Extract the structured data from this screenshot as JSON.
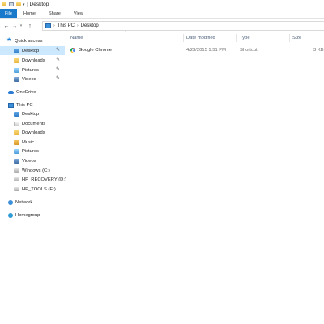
{
  "window": {
    "title": "Desktop"
  },
  "ribbon": {
    "tabs": [
      "File",
      "Home",
      "Share",
      "View"
    ]
  },
  "address": {
    "crumbs": [
      "This PC",
      "Desktop"
    ]
  },
  "nav": {
    "quick_access": "Quick access",
    "quick_items": [
      "Desktop",
      "Downloads",
      "Pictures",
      "Videos"
    ],
    "onedrive": "OneDrive",
    "this_pc": "This PC",
    "pc_items": [
      "Desktop",
      "Documents",
      "Downloads",
      "Music",
      "Pictures",
      "Videos",
      "Windows (C:)",
      "HP_RECOVERY (D:)",
      "HP_TOOLS (E:)"
    ],
    "network": "Network",
    "homegroup": "Homegroup"
  },
  "columns": {
    "name": "Name",
    "date": "Date modified",
    "type": "Type",
    "size": "Size"
  },
  "files": [
    {
      "name": "Google Chrome",
      "date": "4/23/2015 1:51 PM",
      "type": "Shortcut",
      "size": "3 KB"
    }
  ]
}
